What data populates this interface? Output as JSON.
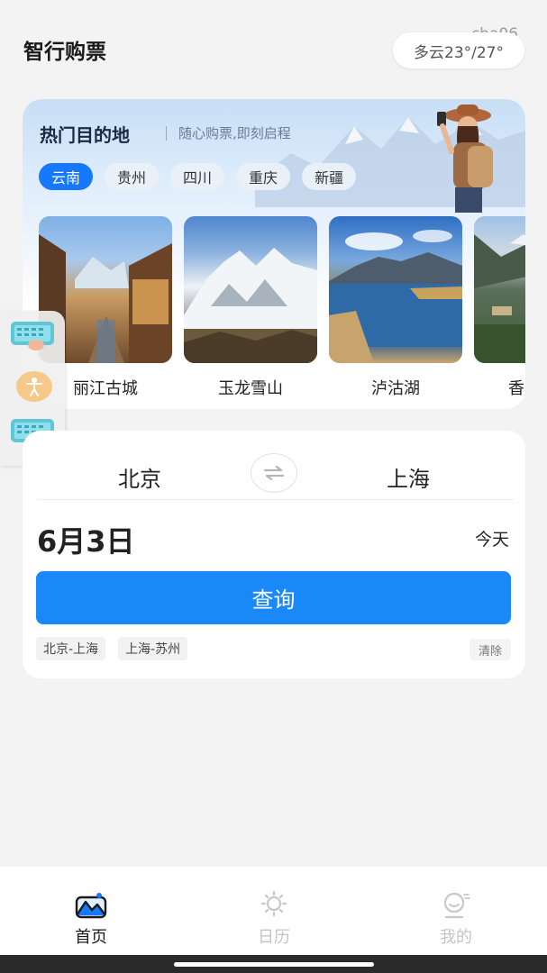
{
  "header": {
    "app_title": "智行购票",
    "watermark": "cba06",
    "weather": "多云23°/27°"
  },
  "destinations": {
    "heading": "热门目的地",
    "subheading": "随心购票,即刻启程",
    "regions": [
      {
        "label": "云南",
        "active": true
      },
      {
        "label": "贵州",
        "active": false
      },
      {
        "label": "四川",
        "active": false
      },
      {
        "label": "重庆",
        "active": false
      },
      {
        "label": "新疆",
        "active": false
      }
    ],
    "places": [
      {
        "label": "丽江古城",
        "image": "old-town-photo"
      },
      {
        "label": "玉龙雪山",
        "image": "snow-mountain-photo"
      },
      {
        "label": "泸沽湖",
        "image": "lake-photo"
      },
      {
        "label": "香格里拉",
        "image": "meadow-photo"
      }
    ]
  },
  "search": {
    "from_city": "北京",
    "to_city": "上海",
    "swap_icon": "swap-arrows-icon",
    "date": "6月3日",
    "date_hint": "今天",
    "query_label": "查询",
    "history": [
      "北京-上海",
      "上海-苏州"
    ],
    "clear_label": "清除"
  },
  "nav": {
    "items": [
      {
        "label": "首页",
        "icon": "home-mountain-icon",
        "active": true
      },
      {
        "label": "日历",
        "icon": "sun-calendar-icon",
        "active": false
      },
      {
        "label": "我的",
        "icon": "profile-icon",
        "active": false
      }
    ]
  },
  "colors": {
    "accent": "#1677ff",
    "query_button": "#1b88f8",
    "background": "#f3f3f3"
  }
}
